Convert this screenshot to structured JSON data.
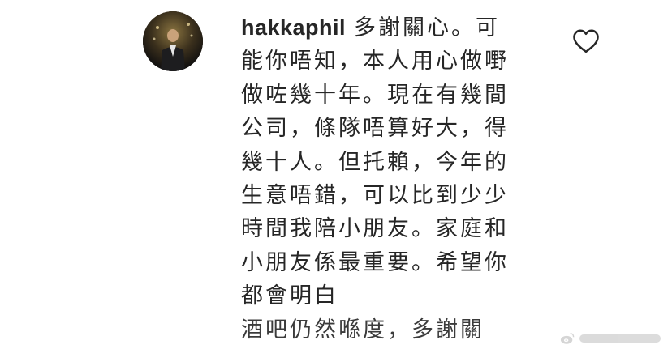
{
  "comment": {
    "username": "hakkaphil",
    "lines": [
      "多謝關心。可",
      "能你唔知，本人用心做嘢",
      "做咗幾十年。現在有幾間",
      "公司，條隊唔算好大，得",
      "幾十人。但托賴，今年的",
      "生意唔錯，可以比到少少",
      "時間我陪小朋友。家庭和",
      "小朋友係最重要。希望你",
      "都會明白",
      "酒吧仍然喺度，多謝關"
    ]
  },
  "icons": {
    "avatar": "profile-photo",
    "like": "heart-outline-icon",
    "watermark": "weibo-watermark-icon"
  },
  "colors": {
    "text": "#262626",
    "background": "#ffffff",
    "icon": "#262626"
  }
}
